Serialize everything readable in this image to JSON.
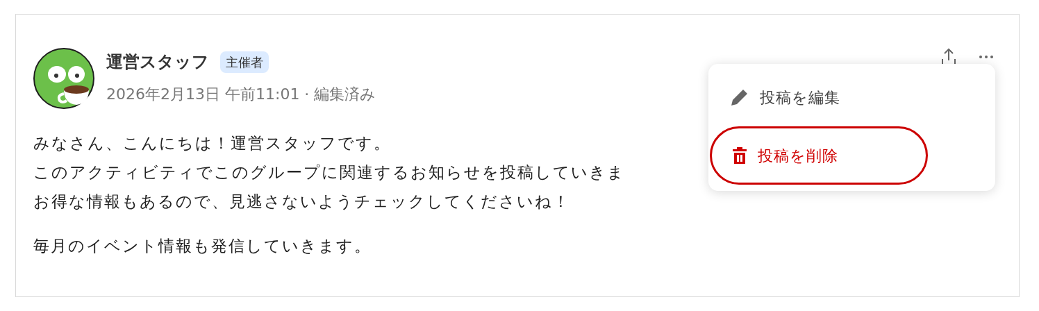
{
  "post": {
    "author": "運営スタッフ",
    "role_badge": "主催者",
    "meta": "2026年2月13日 午前11:01 · 編集済み",
    "paragraphs": [
      [
        "みなさん、こんにちは！運営スタッフです。",
        "このアクティビティでこのグループに関連するお知らせを投稿していきま",
        "お得な情報もあるので、見逃さないようチェックしてくださいね！"
      ],
      [
        "毎月のイベント情報も発信していきます。"
      ]
    ]
  },
  "menu": {
    "items": [
      {
        "kind": "edit",
        "label": "投稿を編集",
        "highlighted": false
      },
      {
        "kind": "delete",
        "label": "投稿を削除",
        "highlighted": true
      }
    ]
  }
}
